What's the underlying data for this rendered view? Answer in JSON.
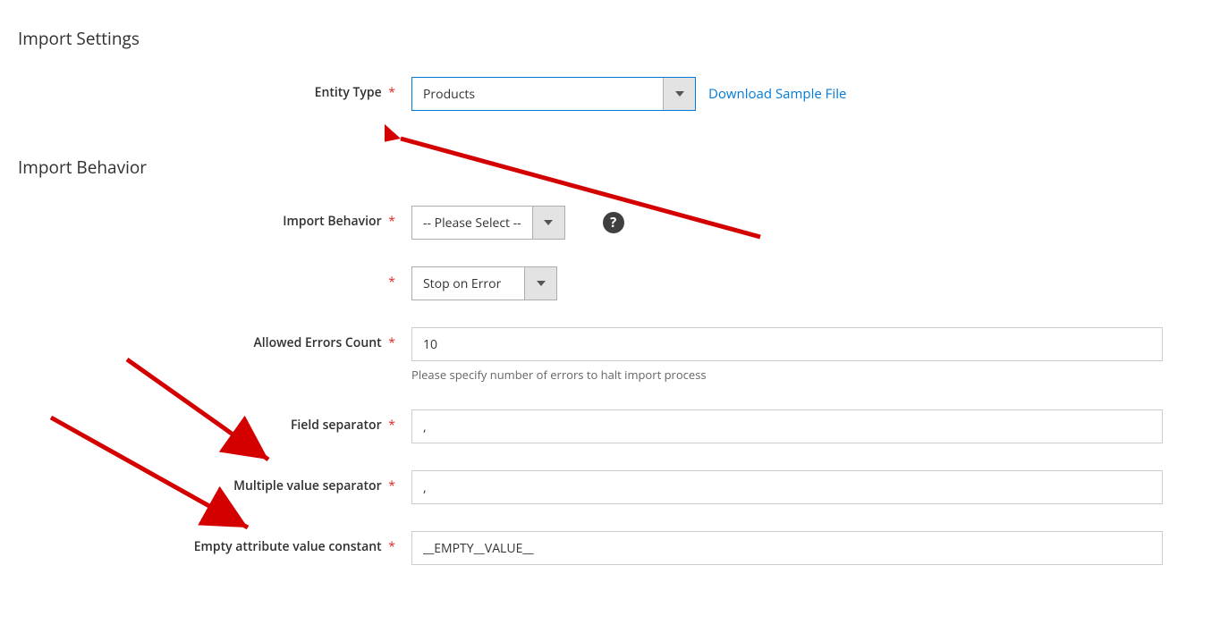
{
  "sections": {
    "import_settings": {
      "title": "Import Settings",
      "entity_type": {
        "label": "Entity Type",
        "value": "Products",
        "download_link": "Download Sample File"
      }
    },
    "import_behavior": {
      "title": "Import Behavior",
      "behavior": {
        "label": "Import Behavior",
        "value": "-- Please Select --"
      },
      "error_strategy": {
        "value": "Stop on Error"
      },
      "allowed_errors": {
        "label": "Allowed Errors Count",
        "value": "10",
        "hint": "Please specify number of errors to halt import process"
      },
      "field_separator": {
        "label": "Field separator",
        "value": ","
      },
      "multiple_separator": {
        "label": "Multiple value separator",
        "value": ","
      },
      "empty_attr": {
        "label": "Empty attribute value constant",
        "value": "__EMPTY__VALUE__"
      }
    }
  },
  "colors": {
    "required": "#e02b27",
    "link": "#007bdb",
    "arrow": "#d40000"
  }
}
